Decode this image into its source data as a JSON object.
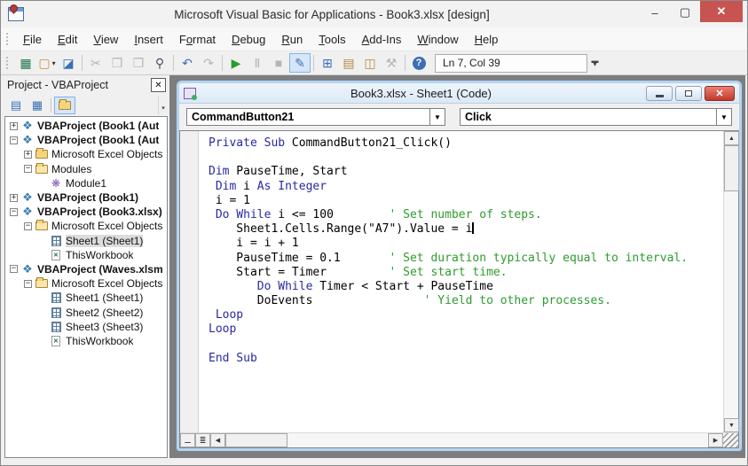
{
  "window": {
    "title": "Microsoft Visual Basic for Applications - Book3.xlsx [design]",
    "app_icon": "vba-application-icon",
    "controls": {
      "minimize": "–",
      "maximize": "▢",
      "close": "✕"
    }
  },
  "menubar": {
    "items": [
      {
        "label": "File",
        "accel_index": 0
      },
      {
        "label": "Edit",
        "accel_index": 0
      },
      {
        "label": "View",
        "accel_index": 0
      },
      {
        "label": "Insert",
        "accel_index": 0
      },
      {
        "label": "Format",
        "accel_index": 1
      },
      {
        "label": "Debug",
        "accel_index": 0
      },
      {
        "label": "Run",
        "accel_index": 0
      },
      {
        "label": "Tools",
        "accel_index": 0
      },
      {
        "label": "Add-Ins",
        "accel_index": 0
      },
      {
        "label": "Window",
        "accel_index": 0
      },
      {
        "label": "Help",
        "accel_index": 0
      }
    ]
  },
  "toolbar": {
    "buttons": [
      {
        "name": "view-microsoft-excel",
        "glyph": "▦",
        "color": "#217346"
      },
      {
        "name": "insert-userform",
        "glyph": "▢",
        "color": "#d78b2a",
        "dropdown": true
      },
      {
        "name": "save",
        "glyph": "◪",
        "color": "#3b6fb5"
      },
      {
        "sep": true
      },
      {
        "name": "cut",
        "glyph": "✂",
        "disabled": true
      },
      {
        "name": "copy",
        "glyph": "❐",
        "disabled": true
      },
      {
        "name": "paste",
        "glyph": "❒",
        "disabled": true
      },
      {
        "name": "find",
        "glyph": "⚲",
        "color": "#44536b"
      },
      {
        "sep": true
      },
      {
        "name": "undo",
        "glyph": "↶",
        "color": "#3b6fb5"
      },
      {
        "name": "redo",
        "glyph": "↷",
        "disabled": true
      },
      {
        "sep": true
      },
      {
        "name": "run-sub",
        "glyph": "▶",
        "color": "#2e9b2e"
      },
      {
        "name": "break",
        "glyph": "Ⅱ",
        "disabled": true
      },
      {
        "name": "reset",
        "glyph": "■",
        "disabled": true
      },
      {
        "name": "design-mode",
        "glyph": "✎",
        "color": "#3b6fb5",
        "active": true
      },
      {
        "sep": true
      },
      {
        "name": "project-explorer",
        "glyph": "⊞",
        "color": "#3b6fb5"
      },
      {
        "name": "properties-window",
        "glyph": "▤",
        "color": "#b58a3b"
      },
      {
        "name": "object-browser",
        "glyph": "◫",
        "color": "#b58a3b"
      },
      {
        "name": "toolbox",
        "glyph": "⚒",
        "disabled": true
      },
      {
        "sep": true
      },
      {
        "name": "help",
        "glyph": "?",
        "help": true
      }
    ],
    "position_indicator": "Ln 7, Col 39"
  },
  "project_panel": {
    "title": "Project - VBAProject",
    "close_glyph": "✕",
    "toolbar": [
      {
        "name": "view-code",
        "glyph": "▤",
        "color": "#3b6fb5"
      },
      {
        "name": "view-object",
        "glyph": "▦",
        "color": "#3b6fb5"
      },
      {
        "sep": true
      },
      {
        "name": "toggle-folders",
        "icon": "folder",
        "active": true
      }
    ],
    "tree": [
      {
        "label": "VBAProject (Book1 (Aut",
        "level": 0,
        "expander": "+",
        "icon": "project",
        "bold": true
      },
      {
        "label": "VBAProject (Book1 (Aut",
        "level": 0,
        "expander": "-",
        "icon": "project",
        "bold": true
      },
      {
        "label": "Microsoft Excel Objects",
        "level": 1,
        "expander": "+",
        "icon": "folder"
      },
      {
        "label": "Modules",
        "level": 1,
        "expander": "-",
        "icon": "folder-open"
      },
      {
        "label": "Module1",
        "level": 2,
        "expander": null,
        "icon": "module"
      },
      {
        "label": "VBAProject (Book1)",
        "level": 0,
        "expander": "+",
        "icon": "project",
        "bold": true
      },
      {
        "label": "VBAProject (Book3.xlsx)",
        "level": 0,
        "expander": "-",
        "icon": "project",
        "bold": true
      },
      {
        "label": "Microsoft Excel Objects",
        "level": 1,
        "expander": "-",
        "icon": "folder-open"
      },
      {
        "label": "Sheet1 (Sheet1)",
        "level": 2,
        "expander": null,
        "icon": "sheet",
        "selected": true
      },
      {
        "label": "ThisWorkbook",
        "level": 2,
        "expander": null,
        "icon": "workbook"
      },
      {
        "label": "VBAProject (Waves.xlsm",
        "level": 0,
        "expander": "-",
        "icon": "project",
        "bold": true
      },
      {
        "label": "Microsoft Excel Objects",
        "level": 1,
        "expander": "-",
        "icon": "folder-open"
      },
      {
        "label": "Sheet1 (Sheet1)",
        "level": 2,
        "expander": null,
        "icon": "sheet"
      },
      {
        "label": "Sheet2 (Sheet2)",
        "level": 2,
        "expander": null,
        "icon": "sheet"
      },
      {
        "label": "Sheet3 (Sheet3)",
        "level": 2,
        "expander": null,
        "icon": "sheet"
      },
      {
        "label": "ThisWorkbook",
        "level": 2,
        "expander": null,
        "icon": "workbook"
      }
    ]
  },
  "code_window": {
    "title": "Book3.xlsx - Sheet1 (Code)",
    "controls": {
      "close": "✕"
    },
    "object_dropdown": "CommandButton21",
    "procedure_dropdown": "Click",
    "code": {
      "keyword_color": "#2828a3",
      "comment_color": "#2e9b2e",
      "lines": [
        {
          "segs": [
            {
              "t": "Private Sub",
              "c": "k"
            },
            {
              "t": " CommandButton21_Click()",
              "c": "n"
            }
          ]
        },
        {
          "segs": []
        },
        {
          "segs": [
            {
              "t": "Dim",
              "c": "k"
            },
            {
              "t": " PauseTime, Start",
              "c": "n"
            }
          ]
        },
        {
          "segs": [
            {
              "t": " ",
              "c": "n"
            },
            {
              "t": "Dim",
              "c": "k"
            },
            {
              "t": " i ",
              "c": "n"
            },
            {
              "t": "As Integer",
              "c": "k"
            }
          ]
        },
        {
          "segs": [
            {
              "t": " i = 1",
              "c": "n"
            }
          ]
        },
        {
          "segs": [
            {
              "t": " ",
              "c": "n"
            },
            {
              "t": "Do While",
              "c": "k"
            },
            {
              "t": " i <= 100        ",
              "c": "n"
            },
            {
              "t": "' Set number of steps.",
              "c": "c"
            }
          ]
        },
        {
          "segs": [
            {
              "t": "    Sheet1.Cells.Range(\"A7\").Value = i",
              "c": "n"
            }
          ],
          "caret": true
        },
        {
          "segs": [
            {
              "t": "    i = i + 1",
              "c": "n"
            }
          ]
        },
        {
          "segs": [
            {
              "t": "    PauseTime = 0.1       ",
              "c": "n"
            },
            {
              "t": "' Set duration typically equal to interval.",
              "c": "c"
            }
          ]
        },
        {
          "segs": [
            {
              "t": "    Start = Timer         ",
              "c": "n"
            },
            {
              "t": "' Set start time.",
              "c": "c"
            }
          ]
        },
        {
          "segs": [
            {
              "t": "       ",
              "c": "n"
            },
            {
              "t": "Do While",
              "c": "k"
            },
            {
              "t": " Timer < Start + PauseTime",
              "c": "n"
            }
          ]
        },
        {
          "segs": [
            {
              "t": "       DoEvents                ",
              "c": "n"
            },
            {
              "t": "' Yield to other processes.",
              "c": "c"
            }
          ]
        },
        {
          "segs": [
            {
              "t": " ",
              "c": "n"
            },
            {
              "t": "Loop",
              "c": "k"
            }
          ]
        },
        {
          "segs": [
            {
              "t": "Loop",
              "c": "k"
            }
          ]
        },
        {
          "segs": []
        },
        {
          "segs": [
            {
              "t": "End Sub",
              "c": "k"
            }
          ]
        }
      ]
    }
  }
}
